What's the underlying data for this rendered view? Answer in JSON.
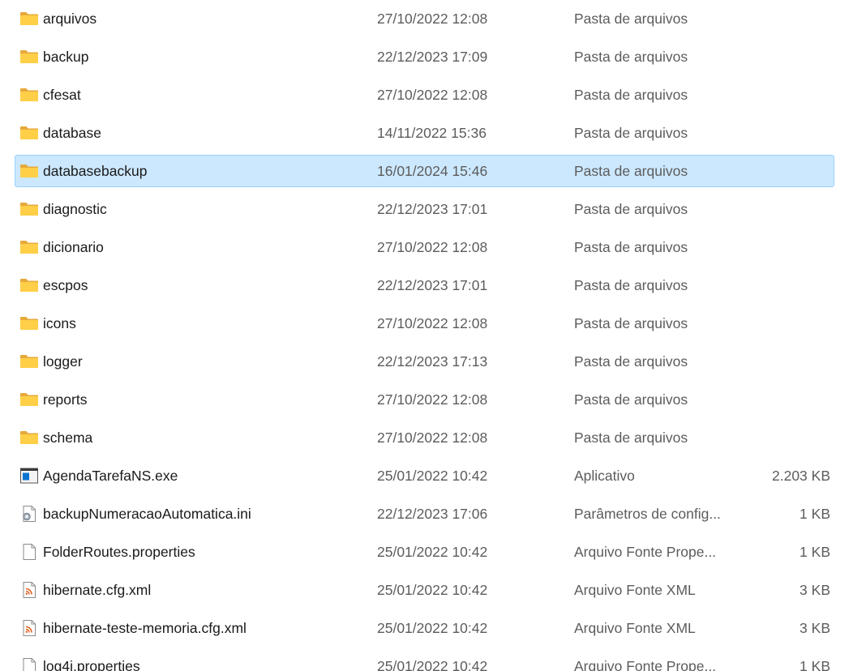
{
  "files": [
    {
      "name": "arquivos",
      "date": "27/10/2022 12:08",
      "type": "Pasta de arquivos",
      "size": "",
      "icon": "folder-icon",
      "selected": false
    },
    {
      "name": "backup",
      "date": "22/12/2023 17:09",
      "type": "Pasta de arquivos",
      "size": "",
      "icon": "folder-icon",
      "selected": false
    },
    {
      "name": "cfesat",
      "date": "27/10/2022 12:08",
      "type": "Pasta de arquivos",
      "size": "",
      "icon": "folder-icon",
      "selected": false
    },
    {
      "name": "database",
      "date": "14/11/2022 15:36",
      "type": "Pasta de arquivos",
      "size": "",
      "icon": "folder-icon",
      "selected": false
    },
    {
      "name": "databasebackup",
      "date": "16/01/2024 15:46",
      "type": "Pasta de arquivos",
      "size": "",
      "icon": "folder-icon",
      "selected": true
    },
    {
      "name": "diagnostic",
      "date": "22/12/2023 17:01",
      "type": "Pasta de arquivos",
      "size": "",
      "icon": "folder-icon",
      "selected": false
    },
    {
      "name": "dicionario",
      "date": "27/10/2022 12:08",
      "type": "Pasta de arquivos",
      "size": "",
      "icon": "folder-icon",
      "selected": false
    },
    {
      "name": "escpos",
      "date": "22/12/2023 17:01",
      "type": "Pasta de arquivos",
      "size": "",
      "icon": "folder-icon",
      "selected": false
    },
    {
      "name": "icons",
      "date": "27/10/2022 12:08",
      "type": "Pasta de arquivos",
      "size": "",
      "icon": "folder-icon",
      "selected": false
    },
    {
      "name": "logger",
      "date": "22/12/2023 17:13",
      "type": "Pasta de arquivos",
      "size": "",
      "icon": "folder-icon",
      "selected": false
    },
    {
      "name": "reports",
      "date": "27/10/2022 12:08",
      "type": "Pasta de arquivos",
      "size": "",
      "icon": "folder-icon",
      "selected": false
    },
    {
      "name": "schema",
      "date": "27/10/2022 12:08",
      "type": "Pasta de arquivos",
      "size": "",
      "icon": "folder-icon",
      "selected": false
    },
    {
      "name": "AgendaTarefaNS.exe",
      "date": "25/01/2022 10:42",
      "type": "Aplicativo",
      "size": "2.203 KB",
      "icon": "application-icon",
      "selected": false
    },
    {
      "name": "backupNumeracaoAutomatica.ini",
      "date": "22/12/2023 17:06",
      "type": "Parâmetros de config...",
      "size": "1 KB",
      "icon": "settings-file-icon",
      "selected": false
    },
    {
      "name": "FolderRoutes.properties",
      "date": "25/01/2022 10:42",
      "type": "Arquivo Fonte Prope...",
      "size": "1 KB",
      "icon": "text-file-icon",
      "selected": false
    },
    {
      "name": "hibernate.cfg.xml",
      "date": "25/01/2022 10:42",
      "type": "Arquivo Fonte XML",
      "size": "3 KB",
      "icon": "xml-file-icon",
      "selected": false
    },
    {
      "name": "hibernate-teste-memoria.cfg.xml",
      "date": "25/01/2022 10:42",
      "type": "Arquivo Fonte XML",
      "size": "3 KB",
      "icon": "xml-file-icon",
      "selected": false
    },
    {
      "name": "log4j.properties",
      "date": "25/01/2022 10:42",
      "type": "Arquivo Fonte Prope...",
      "size": "1 KB",
      "icon": "text-file-icon",
      "selected": false
    }
  ]
}
